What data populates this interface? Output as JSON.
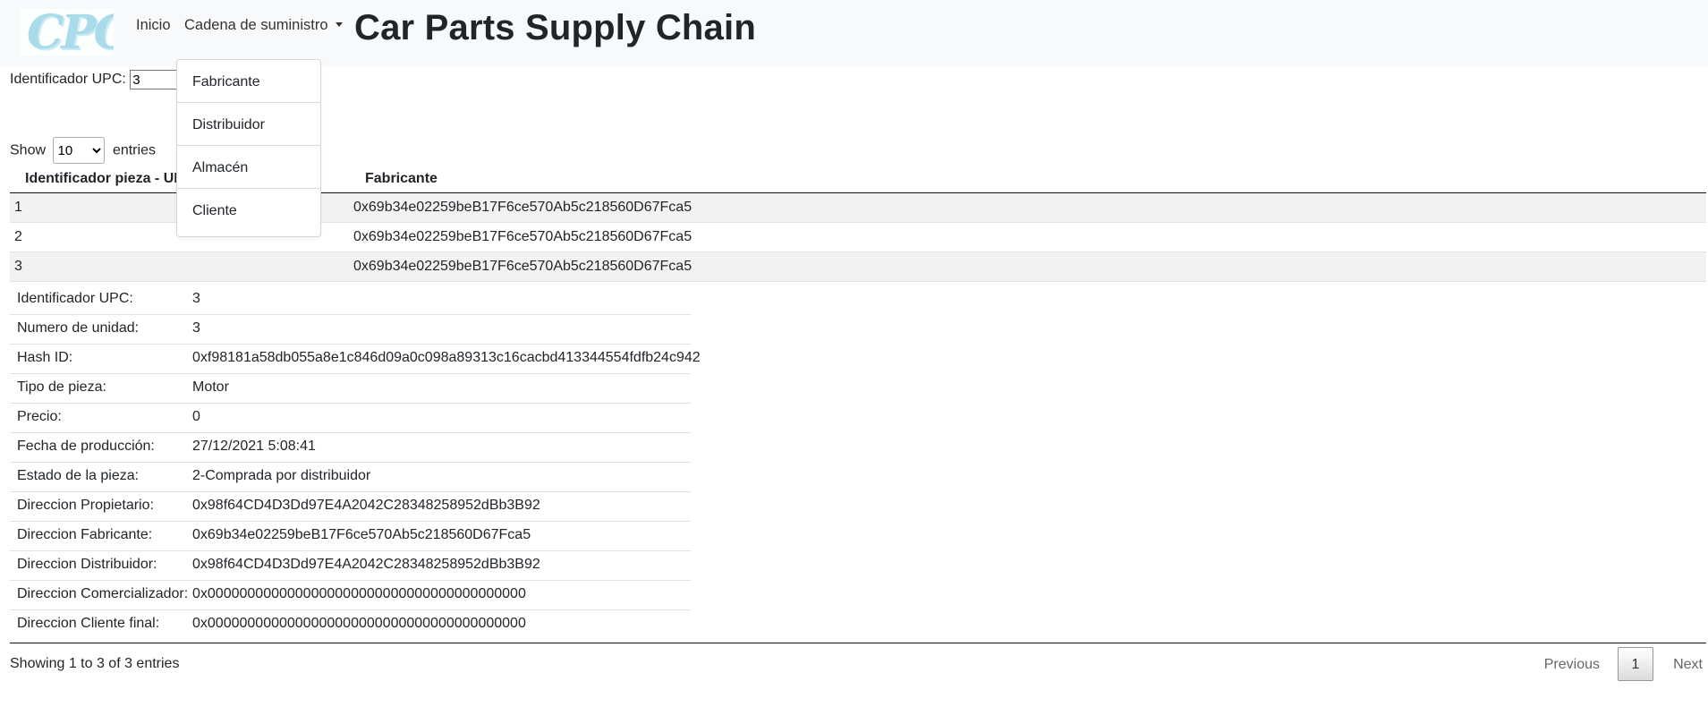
{
  "navbar": {
    "logo_text": "CPC",
    "home": "Inicio",
    "supply_chain": "Cadena de suministro",
    "brand": "Car Parts Supply Chain"
  },
  "dropdown": {
    "items": [
      "Fabricante",
      "Distribuidor",
      "Almacén",
      "Cliente"
    ]
  },
  "upc_search": {
    "label": "Identificador UPC:",
    "value": "3"
  },
  "table": {
    "show_label": "Show",
    "entries_label": "entries",
    "page_size": "10",
    "headers": [
      "Identificador pieza - UPC",
      "Fabricante"
    ],
    "rows": [
      [
        "1",
        "0x69b34e02259beB17F6ce570Ab5c218560D67Fca5"
      ],
      [
        "2",
        "0x69b34e02259beB17F6ce570Ab5c218560D67Fca5"
      ],
      [
        "3",
        "0x69b34e02259beB17F6ce570Ab5c218560D67Fca5"
      ]
    ]
  },
  "details": [
    {
      "label": "Identificador UPC:",
      "value": "3"
    },
    {
      "label": "Numero de unidad:",
      "value": "3"
    },
    {
      "label": "Hash ID:",
      "value": "0xf98181a58db055a8e1c846d09a0c098a89313c16cacbd413344554fdfb24c942"
    },
    {
      "label": "Tipo de pieza:",
      "value": "Motor"
    },
    {
      "label": "Precio:",
      "value": "0"
    },
    {
      "label": "Fecha de producción:",
      "value": "27/12/2021 5:08:41"
    },
    {
      "label": "Estado de la pieza:",
      "value": "2-Comprada por distribuidor"
    },
    {
      "label": "Direccion Propietario:",
      "value": "0x98f64CD4D3Dd97E4A2042C28348258952dBb3B92"
    },
    {
      "label": "Direccion Fabricante:",
      "value": "0x69b34e02259beB17F6ce570Ab5c218560D67Fca5"
    },
    {
      "label": "Direccion Distribuidor:",
      "value": "0x98f64CD4D3Dd97E4A2042C28348258952dBb3B92"
    },
    {
      "label": "Direccion Comercializador:",
      "value": "0x0000000000000000000000000000000000000000"
    },
    {
      "label": "Direccion Cliente final:",
      "value": "0x0000000000000000000000000000000000000000"
    }
  ],
  "footer": {
    "info": "Showing 1 to 3 of 3 entries",
    "previous": "Previous",
    "page": "1",
    "next": "Next"
  }
}
